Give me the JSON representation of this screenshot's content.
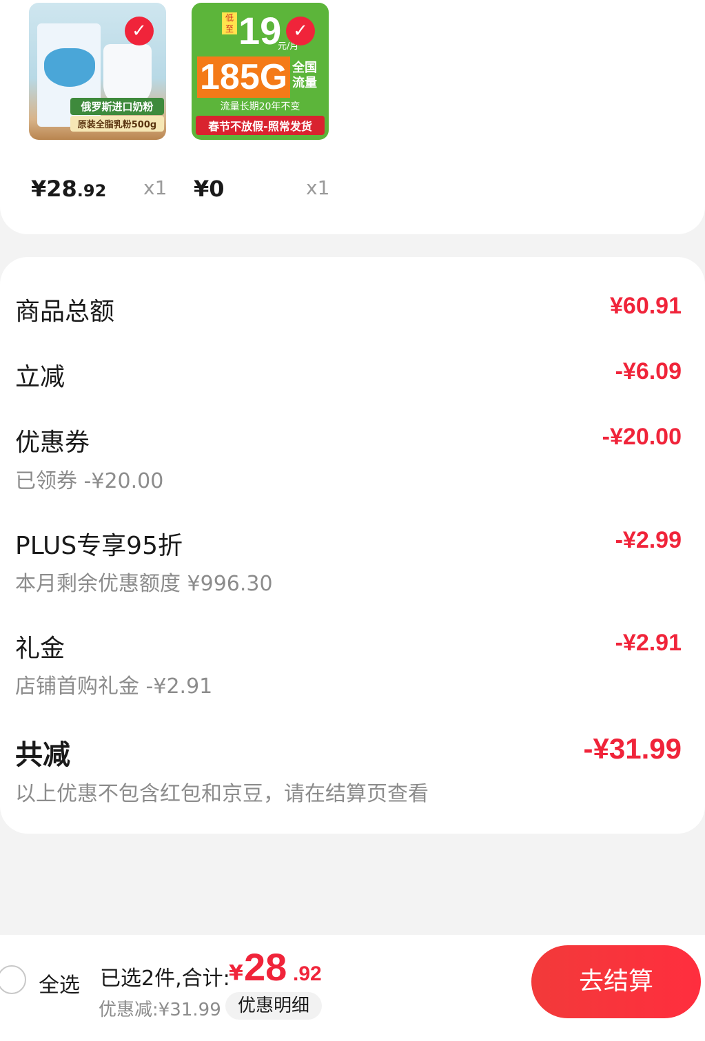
{
  "products": [
    {
      "image_caption_line1": "俄罗斯进口奶粉",
      "image_caption_line2": "原装全脂乳粉500g",
      "price_int": "¥28",
      "price_dec": ".92",
      "qty": "x1"
    },
    {
      "image_top": "低至",
      "image_price": "19",
      "image_unit": "元/月",
      "image_big": "185G",
      "image_tag": "全国流量",
      "image_line1": "流量长期20年不变",
      "image_line2": "春节不放假-照常发货",
      "price_int": "¥0",
      "price_dec": "",
      "qty": "x1"
    }
  ],
  "summary": {
    "goods_total_label": "商品总额",
    "goods_total_value": "¥60.91",
    "instant_label": "立减",
    "instant_value": "-¥6.09",
    "coupon_label": "优惠券",
    "coupon_value": "-¥20.00",
    "coupon_sub": "已领券 -¥20.00",
    "plus_label": "PLUS专享95折",
    "plus_value": "-¥2.99",
    "plus_sub": "本月剩余优惠额度 ¥996.30",
    "gift_label": "礼金",
    "gift_value": "-¥2.91",
    "gift_sub": "店铺首购礼金 -¥2.91",
    "total_label": "共减",
    "total_value": "-¥31.99",
    "total_sub": "以上优惠不包含红包和京豆，请在结算页查看"
  },
  "bottom_bar": {
    "select_all": "全选",
    "selected_text": "已选2件,合计:",
    "currency": "¥",
    "total_int": "28",
    "total_dec": ".92",
    "discount_text": "优惠减:¥31.99",
    "detail_button": "优惠明细",
    "checkout_button": "去结算"
  },
  "colors": {
    "accent_red": "#f0243a",
    "gray_text": "#8c8c8c",
    "background": "#f3f3f3"
  }
}
